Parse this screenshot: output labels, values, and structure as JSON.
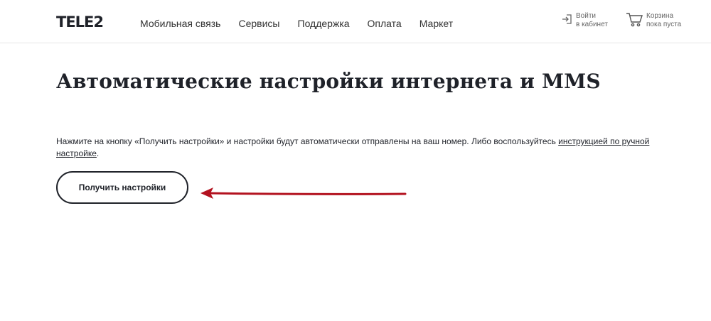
{
  "header": {
    "logo": "TELE2",
    "nav": [
      {
        "label": "Мобильная связь"
      },
      {
        "label": "Сервисы"
      },
      {
        "label": "Поддержка"
      },
      {
        "label": "Оплата"
      },
      {
        "label": "Маркет"
      }
    ],
    "login": {
      "line1": "Войти",
      "line2": "в кабинет",
      "icon": "login-icon"
    },
    "cart": {
      "line1": "Корзина",
      "line2": "пока пуста",
      "icon": "cart-icon"
    }
  },
  "main": {
    "title": "Автоматические настройки интернета и MMS",
    "description": {
      "text": "Нажмите на кнопку «Получить настройки» и настройки будут автоматически отправлены на ваш номер. Либо воспользуйтесь ",
      "link": "инструкцией по ручной настройке",
      "after": "."
    },
    "button_label": "Получить настройки"
  },
  "annotation": {
    "arrow_color": "#b3121f"
  }
}
